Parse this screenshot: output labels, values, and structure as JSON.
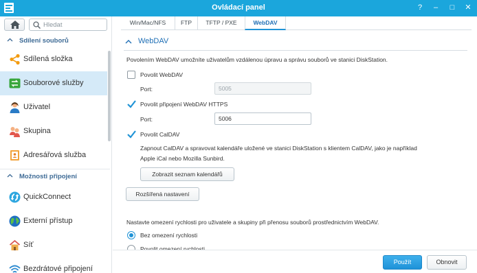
{
  "window": {
    "title": "Ovládací panel",
    "controls": [
      "?",
      "–",
      "□",
      "✕"
    ]
  },
  "sidebar": {
    "search_placeholder": "Hledat",
    "sections": [
      {
        "label": "Sdílení souborů"
      },
      {
        "label": "Možnosti připojení"
      }
    ],
    "items": [
      {
        "label": "Sdílená složka",
        "icon": "share-folder-icon"
      },
      {
        "label": "Souborové služby",
        "icon": "file-services-icon",
        "active": true
      },
      {
        "label": "Uživatel",
        "icon": "user-icon"
      },
      {
        "label": "Skupina",
        "icon": "group-icon"
      },
      {
        "label": "Adresářová služba",
        "icon": "directory-service-icon"
      },
      {
        "label": "QuickConnect",
        "icon": "quickconnect-icon"
      },
      {
        "label": "Externí přístup",
        "icon": "globe-icon"
      },
      {
        "label": "Síť",
        "icon": "network-icon"
      },
      {
        "label": "Bezdrátové připojení",
        "icon": "wifi-icon"
      }
    ]
  },
  "tabs": [
    {
      "label": "Win/Mac/NFS"
    },
    {
      "label": "FTP"
    },
    {
      "label": "TFTP / PXE"
    },
    {
      "label": "WebDAV",
      "active": true
    }
  ],
  "webdav": {
    "title": "WebDAV",
    "description": "Povolením WebDAV umožníte uživatelům vzdálenou úpravu a správu souborů ve stanici DiskStation.",
    "enable_webdav": {
      "label": "Povolit WebDAV",
      "checked": false
    },
    "port_label": "Port:",
    "http_port": "5005",
    "enable_https": {
      "label": "Povolit připojení WebDAV HTTPS",
      "checked": true
    },
    "https_port": "5006",
    "enable_caldav": {
      "label": "Povolit CalDAV",
      "checked": true
    },
    "caldav_desc_1": "Zapnout CalDAV a spravovat kalendáře uložené ve stanici DiskStation s klientem CalDAV, jako je například",
    "caldav_desc_2": "Apple iCal nebo Mozilla Sunbird.",
    "show_calendars_button": "Zobrazit seznam kalendářů",
    "advanced_button": "Rozšířená nastavení",
    "speed_desc": "Nastavte omezení rychlosti pro uživatele a skupiny při přenosu souborů prostřednictvím WebDAV.",
    "speed_options": [
      {
        "label": "Bez omezení rychlosti",
        "selected": true
      },
      {
        "label": "Povolit omezení rychlosti",
        "selected": false
      }
    ]
  },
  "footer": {
    "apply": "Použít",
    "reset": "Obnovit"
  },
  "colors": {
    "titlebar": "#1ba6dc",
    "accent": "#1f93d6",
    "active_item": "#d5eaf8"
  }
}
